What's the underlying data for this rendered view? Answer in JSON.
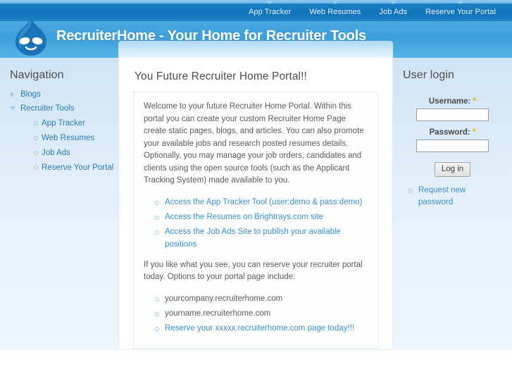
{
  "site": {
    "title": "RecruiterHome - Your Home for Recruiter Tools",
    "logo_icon": "drupal-droplet-icon"
  },
  "primary_nav": {
    "items": [
      {
        "label": "App Tracker",
        "caret_icon": "caret-down-icon"
      },
      {
        "label": "Web Resumes",
        "caret_icon": "caret-down-icon"
      },
      {
        "label": "Job Ads",
        "caret_icon": "caret-down-icon"
      },
      {
        "label": "Reserve Your Portal",
        "caret_icon": "caret-down-icon"
      }
    ]
  },
  "sidebar_left": {
    "block_title": "Navigation",
    "items": [
      {
        "label": "Blogs",
        "marker_icon": "triangle-right-icon",
        "expanded": false
      },
      {
        "label": "Recruiter Tools",
        "marker_icon": "triangle-down-icon",
        "expanded": true
      }
    ],
    "sub_items": [
      {
        "label": "App Tracker",
        "marker_icon": "circle-bullet-icon"
      },
      {
        "label": "Web Resumes",
        "marker_icon": "circle-bullet-icon"
      },
      {
        "label": "Job Ads",
        "marker_icon": "circle-bullet-icon"
      },
      {
        "label": "Reserve Your Portal",
        "marker_icon": "circle-bullet-icon"
      }
    ]
  },
  "main": {
    "heading": "You Future Recruiter Home Portal!!",
    "intro_paragraph": "Welcome to your future Recruiter Home Portal. Within this portal you can create your custom Recruiter Home Page create static pages, blogs, and articles. You can also promote your available jobs and research posted resumes details. Optionally, you may manage your job orders, candidates and clients using the open source tools (such as the Applicant Tracking System) made available to you.",
    "tool_links": [
      {
        "label": "Access the App Tracker Tool (user:demo & pass:demo)",
        "marker_icon": "circle-bullet-icon"
      },
      {
        "label": "Access the Resumes on Brightrays.com site",
        "marker_icon": "circle-bullet-icon"
      },
      {
        "label": "Access the Job Ads Site to publish your available positions",
        "marker_icon": "circle-bullet-icon"
      }
    ],
    "reserve_paragraph": "If you like what you see, you can reserve your recruiter portal today. Options to your portal page include:",
    "portal_options": [
      {
        "label": "yourcompany.recruiterhome.com",
        "marker_icon": "circle-bullet-icon",
        "is_link": false
      },
      {
        "label": "yourname.recruiterhome.com",
        "marker_icon": "circle-bullet-icon",
        "is_link": false
      },
      {
        "label": "Reserve your xxxxx.recruiterhome.com page today!!!",
        "marker_icon": "circle-bullet-icon",
        "is_link": true
      }
    ]
  },
  "sidebar_right": {
    "block_title": "User login",
    "username_label": "Username:",
    "username_value": "",
    "password_label": "Password:",
    "password_value": "",
    "required_marker": "*",
    "submit_label": "Log in",
    "links": [
      {
        "label": "Request new password",
        "marker_icon": "circle-bullet-icon"
      }
    ]
  },
  "colors": {
    "banner_blue": "#3d9fdb",
    "nav_blue": "#1273b9",
    "link_blue": "#3a8dc8",
    "sidebar_blue": "#dcebf8",
    "required_orange": "#f0a30a"
  }
}
